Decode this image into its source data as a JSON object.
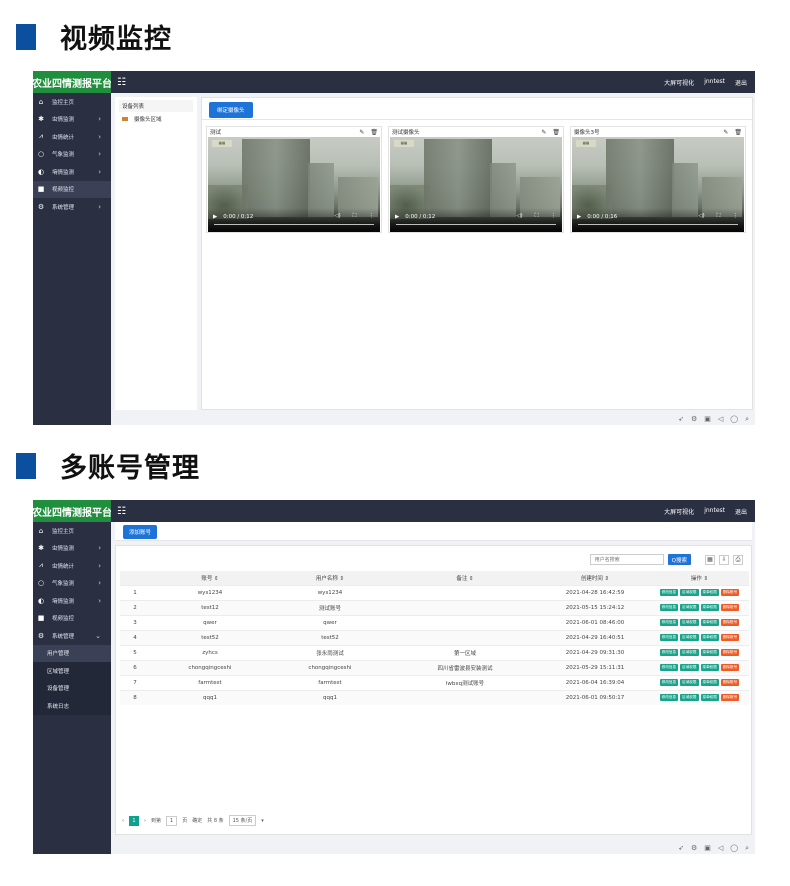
{
  "section1": {
    "title": "视频监控"
  },
  "section2": {
    "title": "多账号管理"
  },
  "app": {
    "brand": "农业四情测报平台",
    "topbar": {
      "screen_label": "大屏可视化",
      "user": "jnntest",
      "logout": "退出"
    }
  },
  "sidebar1": [
    {
      "icon": "home-icon",
      "label": "监控主页",
      "arrow": false
    },
    {
      "icon": "bug-icon",
      "label": "虫情监测",
      "arrow": true
    },
    {
      "icon": "chart-icon",
      "label": "虫情统计",
      "arrow": true
    },
    {
      "icon": "weather-icon",
      "label": "气象监测",
      "arrow": true
    },
    {
      "icon": "soil-icon",
      "label": "墒情监测",
      "arrow": true
    },
    {
      "icon": "camera-icon",
      "label": "视频监控",
      "arrow": false,
      "active": true
    },
    {
      "icon": "gear-icon",
      "label": "系统管理",
      "arrow": true
    }
  ],
  "sidebar2": [
    {
      "icon": "home-icon",
      "label": "监控主页",
      "arrow": false
    },
    {
      "icon": "bug-icon",
      "label": "虫情监测",
      "arrow": true
    },
    {
      "icon": "chart-icon",
      "label": "虫情统计",
      "arrow": true
    },
    {
      "icon": "weather-icon",
      "label": "气象监测",
      "arrow": true
    },
    {
      "icon": "soil-icon",
      "label": "墒情监测",
      "arrow": true
    },
    {
      "icon": "camera-icon",
      "label": "视频监控",
      "arrow": false
    },
    {
      "icon": "gear-icon",
      "label": "系统管理",
      "arrow": true,
      "expanded": true
    }
  ],
  "sidebar2_sub": [
    {
      "label": "用户管理",
      "active": true
    },
    {
      "label": "区域管理"
    },
    {
      "label": "设备管理"
    },
    {
      "label": "系统日志"
    }
  ],
  "video_page": {
    "tree_header": "设备列表",
    "tree_node": "摄像头区域",
    "bind_button": "绑定摄像头",
    "cards": [
      {
        "title": "测试",
        "time": "0:00 / 0:12"
      },
      {
        "title": "测试摄像头",
        "time": "0:00 / 0:12"
      },
      {
        "title": "摄像头3号",
        "time": "0:00 / 0:16"
      }
    ]
  },
  "user_page": {
    "add_button": "添加账号",
    "search_placeholder": "用户名搜索",
    "search_button": "Q搜索",
    "columns": [
      "",
      "账号 ⇕",
      "用户名称 ⇕",
      "备注 ⇕",
      "创建时间 ⇕",
      "操作 ⇕"
    ],
    "rows": [
      [
        "1",
        "wys1234",
        "wys1234",
        "",
        "2021-04-28 16:42:59"
      ],
      [
        "2",
        "test12",
        "测试账号",
        "",
        "2021-05-15 15:24:12"
      ],
      [
        "3",
        "qwer",
        "qwer",
        "",
        "2021-06-01 08:46:00"
      ],
      [
        "4",
        "test52",
        "test52",
        "",
        "2021-04-29 16:40:51"
      ],
      [
        "5",
        "zyhcs",
        "张永雨测试",
        "第一区域",
        "2021-04-29 09:31:30"
      ],
      [
        "6",
        "chongqingceshi",
        "chongqingceshi",
        "四川省雷波县安装测试",
        "2021-05-29 15:11:31"
      ],
      [
        "7",
        "farmtest",
        "farmtest",
        "lwbxq测试账号",
        "2021-06-04 16:39:04"
      ],
      [
        "8",
        "qqq1",
        "qqq1",
        "",
        "2021-06-01 09:50:17"
      ]
    ],
    "actions": [
      "修改信息",
      "区域权限",
      "菜单权限",
      "删除账号"
    ],
    "pager": {
      "page": "1",
      "goto_label": "到第",
      "goto_value": "1",
      "page_unit": "页",
      "confirm": "确定",
      "total": "共 8 条",
      "per_page": "15 条/页"
    }
  },
  "footer_icons": [
    "rocket-icon",
    "settings-icon",
    "delete-icon",
    "volume-icon",
    "chat-icon",
    "search-icon"
  ]
}
